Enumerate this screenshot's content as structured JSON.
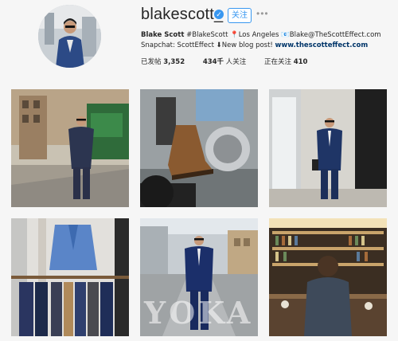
{
  "profile": {
    "username": "blakescott_",
    "follow_label": "关注",
    "more_label": "•••",
    "bio": {
      "name": "Blake Scott",
      "text": "#BlakeScott 📍Los Angeles 📧Blake@TheScottEffect.com Snapchat: ScottEffect ⬇New blog post!",
      "link": "www.thescotteffect.com"
    },
    "stats": [
      {
        "label": "已发帖",
        "value": "3,352"
      },
      {
        "label": "人关注",
        "value": "434千"
      },
      {
        "label": "正在关注",
        "value": "410"
      }
    ]
  },
  "posts": [
    {
      "name": "post-street-suit"
    },
    {
      "name": "post-motorcycle-boots"
    },
    {
      "name": "post-storefront-suit"
    },
    {
      "name": "post-jacket-rack"
    },
    {
      "name": "post-city-street-suit"
    },
    {
      "name": "post-bar-interior"
    }
  ],
  "watermark": "YOKA"
}
